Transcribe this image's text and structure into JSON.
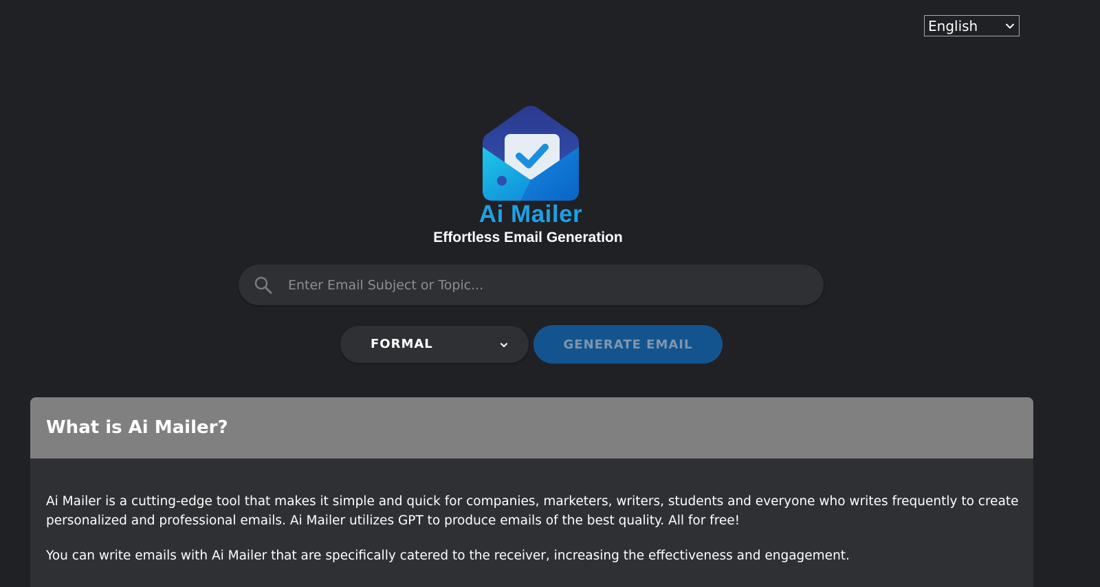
{
  "language_selector": {
    "selected": "English"
  },
  "brand": {
    "name": "Ai Mailer",
    "tagline": "Effortless Email Generation",
    "logo_icon": "envelope-check-icon"
  },
  "search": {
    "placeholder": "Enter Email Subject or Topic...",
    "value": "",
    "icon": "search-icon"
  },
  "tone_selector": {
    "selected": "FORMAL"
  },
  "generate_button": {
    "label": "GENERATE EMAIL"
  },
  "info_card": {
    "title": "What is Ai Mailer?",
    "paragraphs": [
      "Ai Mailer is a cutting-edge tool that makes it simple and quick for companies, marketers, writers, students and everyone who writes frequently to create personalized and professional emails. Ai Mailer utilizes GPT to produce emails of the best quality. All for free!",
      "You can write emails with Ai Mailer that are specifically catered to the receiver, increasing the effectiveness and engagement."
    ]
  },
  "colors": {
    "background": "#202125",
    "surface": "#2f3034",
    "brand_blue": "#1ea0e6",
    "button_blue": "#13548e",
    "card_header": "#808080"
  }
}
